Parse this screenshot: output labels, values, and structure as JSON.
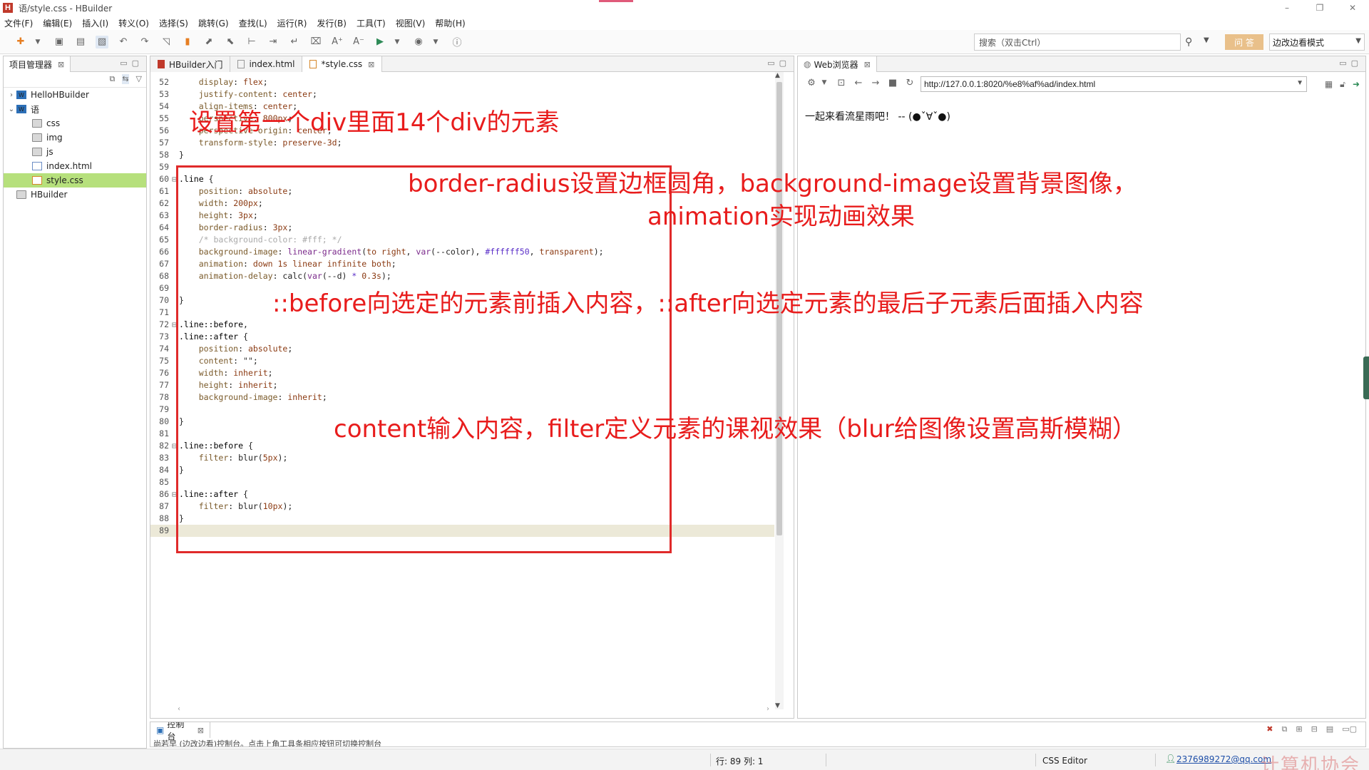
{
  "window": {
    "title": "语/style.css  -  HBuilder",
    "logo": "H",
    "controls": [
      "–",
      "❐",
      "✕"
    ]
  },
  "menu": [
    "文件(F)",
    "编辑(E)",
    "插入(I)",
    "转义(O)",
    "选择(S)",
    "跳转(G)",
    "查找(L)",
    "运行(R)",
    "发行(B)",
    "工具(T)",
    "视图(V)",
    "帮助(H)"
  ],
  "toolbar": {
    "search_placeholder": "搜索（双击Ctrl）",
    "ask_label": "问 答",
    "mode_label": "边改边看模式"
  },
  "project": {
    "tab_label": "项目管理器",
    "tree": [
      {
        "label": "HelloHBuilder",
        "twisty": "›",
        "icon": "W",
        "depth": 0,
        "kind": "proj"
      },
      {
        "label": "语",
        "twisty": "⌄",
        "icon": "W",
        "depth": 0,
        "kind": "proj"
      },
      {
        "label": "css",
        "twisty": "",
        "icon": "",
        "depth": 1,
        "kind": "folder"
      },
      {
        "label": "img",
        "twisty": "",
        "icon": "",
        "depth": 1,
        "kind": "folder"
      },
      {
        "label": "js",
        "twisty": "",
        "icon": "",
        "depth": 1,
        "kind": "folder"
      },
      {
        "label": "index.html",
        "twisty": "",
        "icon": "",
        "depth": 1,
        "kind": "file-html"
      },
      {
        "label": "style.css",
        "twisty": "",
        "icon": "",
        "depth": 1,
        "kind": "file-css",
        "selected": true
      },
      {
        "label": "HBuilder",
        "twisty": "",
        "icon": "",
        "depth": 0,
        "kind": "folder"
      }
    ]
  },
  "editor": {
    "tabs": [
      {
        "label": "HBuilder入门",
        "icon": "red",
        "active": false,
        "closable": false
      },
      {
        "label": "index.html",
        "icon": "html",
        "active": false,
        "closable": false
      },
      {
        "label": "*style.css",
        "icon": "css",
        "active": true,
        "closable": true
      }
    ],
    "lines": [
      {
        "n": "52",
        "fold": "",
        "parts": [
          [
            "    ",
            ""
          ],
          [
            "display",
            "c-prop"
          ],
          [
            ": ",
            ""
          ],
          [
            "flex",
            "c-val"
          ],
          [
            ";",
            ""
          ]
        ]
      },
      {
        "n": "53",
        "fold": "",
        "parts": [
          [
            "    ",
            ""
          ],
          [
            "justify-content",
            "c-prop"
          ],
          [
            ": ",
            ""
          ],
          [
            "center",
            "c-val"
          ],
          [
            ";",
            ""
          ]
        ]
      },
      {
        "n": "54",
        "fold": "",
        "parts": [
          [
            "    ",
            ""
          ],
          [
            "align-items",
            "c-prop"
          ],
          [
            ": ",
            ""
          ],
          [
            "center",
            "c-val"
          ],
          [
            ";",
            ""
          ]
        ]
      },
      {
        "n": "55",
        "fold": "",
        "parts": [
          [
            "    ",
            ""
          ],
          [
            "perspective",
            "c-prop"
          ],
          [
            ": ",
            ""
          ],
          [
            "800px",
            "c-val"
          ],
          [
            ";",
            ""
          ]
        ]
      },
      {
        "n": "56",
        "fold": "",
        "parts": [
          [
            "    ",
            ""
          ],
          [
            "perspective-origin",
            "c-prop"
          ],
          [
            ": ",
            ""
          ],
          [
            "center",
            "c-val"
          ],
          [
            ";",
            ""
          ]
        ]
      },
      {
        "n": "57",
        "fold": "",
        "parts": [
          [
            "    ",
            ""
          ],
          [
            "transform-style",
            "c-prop"
          ],
          [
            ": ",
            ""
          ],
          [
            "preserve-3d",
            "c-val"
          ],
          [
            ";",
            ""
          ]
        ]
      },
      {
        "n": "58",
        "fold": "",
        "parts": [
          [
            "}",
            ""
          ]
        ]
      },
      {
        "n": "59",
        "fold": "",
        "parts": []
      },
      {
        "n": "60",
        "fold": "⊟",
        "parts": [
          [
            ".line ",
            "c-sel"
          ],
          [
            "{",
            ""
          ]
        ]
      },
      {
        "n": "61",
        "fold": "",
        "parts": [
          [
            "    ",
            ""
          ],
          [
            "position",
            "c-prop"
          ],
          [
            ": ",
            ""
          ],
          [
            "absolute",
            "c-val"
          ],
          [
            ";",
            ""
          ]
        ]
      },
      {
        "n": "62",
        "fold": "",
        "parts": [
          [
            "    ",
            ""
          ],
          [
            "width",
            "c-prop"
          ],
          [
            ": ",
            ""
          ],
          [
            "200px",
            "c-val"
          ],
          [
            ";",
            ""
          ]
        ]
      },
      {
        "n": "63",
        "fold": "",
        "parts": [
          [
            "    ",
            ""
          ],
          [
            "height",
            "c-prop"
          ],
          [
            ": ",
            ""
          ],
          [
            "3px",
            "c-val"
          ],
          [
            ";",
            ""
          ]
        ]
      },
      {
        "n": "64",
        "fold": "",
        "parts": [
          [
            "    ",
            ""
          ],
          [
            "border-radius",
            "c-prop"
          ],
          [
            ": ",
            ""
          ],
          [
            "3px",
            "c-val"
          ],
          [
            ";",
            ""
          ]
        ]
      },
      {
        "n": "65",
        "fold": "",
        "parts": [
          [
            "    ",
            ""
          ],
          [
            "/* background-color: #fff; */",
            "c-com"
          ]
        ]
      },
      {
        "n": "66",
        "fold": "",
        "parts": [
          [
            "    ",
            ""
          ],
          [
            "background-image",
            "c-prop"
          ],
          [
            ": ",
            ""
          ],
          [
            "linear-gradient",
            "c-fn"
          ],
          [
            "(",
            ""
          ],
          [
            "to right",
            "c-val"
          ],
          [
            ", ",
            ""
          ],
          [
            "var",
            "c-fn"
          ],
          [
            "(--color), ",
            ""
          ],
          [
            "#ffffff50",
            "c-hex"
          ],
          [
            ", ",
            ""
          ],
          [
            "transparent",
            "c-val"
          ],
          [
            ");",
            ""
          ]
        ]
      },
      {
        "n": "67",
        "fold": "",
        "parts": [
          [
            "    ",
            ""
          ],
          [
            "animation",
            "c-prop"
          ],
          [
            ": ",
            ""
          ],
          [
            "down 1s linear infinite both",
            "c-val"
          ],
          [
            ";",
            ""
          ]
        ]
      },
      {
        "n": "68",
        "fold": "",
        "parts": [
          [
            "    ",
            ""
          ],
          [
            "animation-delay",
            "c-prop"
          ],
          [
            ": ",
            ""
          ],
          [
            "calc(",
            ""
          ],
          [
            "var",
            "c-fn"
          ],
          [
            "(--d) ",
            ""
          ],
          [
            "*",
            "c-hex"
          ],
          [
            " ",
            ""
          ],
          [
            "0.3s",
            "c-val"
          ],
          [
            ");",
            ""
          ]
        ]
      },
      {
        "n": "69",
        "fold": "",
        "parts": []
      },
      {
        "n": "70",
        "fold": "",
        "parts": [
          [
            "}",
            ""
          ]
        ]
      },
      {
        "n": "71",
        "fold": "",
        "parts": []
      },
      {
        "n": "72",
        "fold": "⊟",
        "parts": [
          [
            ".line::before",
            "c-sel"
          ],
          [
            ",",
            ""
          ]
        ]
      },
      {
        "n": "73",
        "fold": "",
        "parts": [
          [
            ".line::after ",
            "c-sel"
          ],
          [
            "{",
            ""
          ]
        ]
      },
      {
        "n": "74",
        "fold": "",
        "parts": [
          [
            "    ",
            ""
          ],
          [
            "position",
            "c-prop"
          ],
          [
            ": ",
            ""
          ],
          [
            "absolute",
            "c-val"
          ],
          [
            ";",
            ""
          ]
        ]
      },
      {
        "n": "75",
        "fold": "",
        "parts": [
          [
            "    ",
            ""
          ],
          [
            "content",
            "c-prop"
          ],
          [
            ": ",
            ""
          ],
          [
            "\"\"",
            "c-str"
          ],
          [
            ";",
            ""
          ]
        ]
      },
      {
        "n": "76",
        "fold": "",
        "parts": [
          [
            "    ",
            ""
          ],
          [
            "width",
            "c-prop"
          ],
          [
            ": ",
            ""
          ],
          [
            "inherit",
            "c-val"
          ],
          [
            ";",
            ""
          ]
        ]
      },
      {
        "n": "77",
        "fold": "",
        "parts": [
          [
            "    ",
            ""
          ],
          [
            "height",
            "c-prop"
          ],
          [
            ": ",
            ""
          ],
          [
            "inherit",
            "c-val"
          ],
          [
            ";",
            ""
          ]
        ]
      },
      {
        "n": "78",
        "fold": "",
        "parts": [
          [
            "    ",
            ""
          ],
          [
            "background-image",
            "c-prop"
          ],
          [
            ": ",
            ""
          ],
          [
            "inherit",
            "c-val"
          ],
          [
            ";",
            ""
          ]
        ]
      },
      {
        "n": "79",
        "fold": "",
        "parts": []
      },
      {
        "n": "80",
        "fold": "",
        "parts": [
          [
            "}",
            ""
          ]
        ]
      },
      {
        "n": "81",
        "fold": "",
        "parts": []
      },
      {
        "n": "82",
        "fold": "⊟",
        "parts": [
          [
            ".line::before ",
            "c-sel"
          ],
          [
            "{",
            ""
          ]
        ]
      },
      {
        "n": "83",
        "fold": "",
        "parts": [
          [
            "    ",
            ""
          ],
          [
            "filter",
            "c-prop"
          ],
          [
            ": ",
            ""
          ],
          [
            "blur(",
            ""
          ],
          [
            "5px",
            "c-val"
          ],
          [
            ");",
            ""
          ]
        ]
      },
      {
        "n": "84",
        "fold": "",
        "parts": [
          [
            "}",
            ""
          ]
        ]
      },
      {
        "n": "85",
        "fold": "",
        "parts": []
      },
      {
        "n": "86",
        "fold": "⊟",
        "parts": [
          [
            ".line::after ",
            "c-sel"
          ],
          [
            "{",
            ""
          ]
        ]
      },
      {
        "n": "87",
        "fold": "",
        "parts": [
          [
            "    ",
            ""
          ],
          [
            "filter",
            "c-prop"
          ],
          [
            ": ",
            ""
          ],
          [
            "blur(",
            ""
          ],
          [
            "10px",
            "c-val"
          ],
          [
            ");",
            ""
          ]
        ]
      },
      {
        "n": "88",
        "fold": "",
        "parts": [
          [
            "}",
            ""
          ]
        ]
      },
      {
        "n": "89",
        "fold": "",
        "parts": [],
        "current": true
      }
    ]
  },
  "browser": {
    "tab_label": "Web浏览器",
    "url": "http://127.0.0.1:8020/%e8%af%ad/index.html",
    "page_text": "一起来看流星雨吧！ -- (●ˇ∀ˇ●)"
  },
  "console": {
    "tab_label": "控制台",
    "text": "尚若早 (边改边看)控制台。点击上角工具条相应按钮可切换控制台"
  },
  "status": {
    "position": "行: 89 列: 1",
    "editor_type": "CSS Editor",
    "user": "2376989272@qq.com",
    "watermark": "计算机协会"
  },
  "annotations": [
    {
      "text": "设置第一个div里面14个div的元素"
    },
    {
      "text": "border-radius设置边框圆角，background-image设置背景图像，"
    },
    {
      "text": "animation实现动画效果"
    },
    {
      "text": "::before向选定的元素前插入内容，::after向选定元素的最后子元素后面插入内容"
    },
    {
      "text": "content输入内容，filter定义元素的课视效果（blur给图像设置高斯模糊）"
    }
  ],
  "colors": {
    "annotation": "#e81c1c",
    "selected_tree": "#b6e07c",
    "current_line": "#ece9d8"
  }
}
